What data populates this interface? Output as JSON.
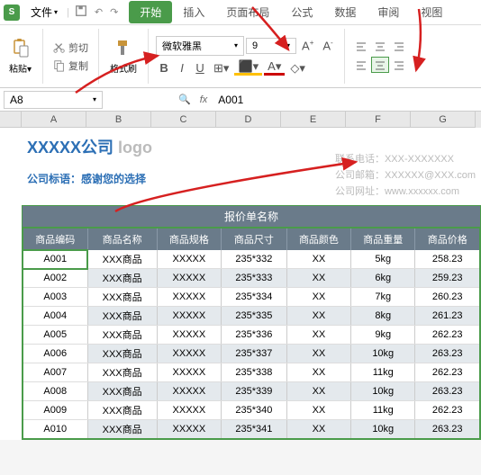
{
  "menubar": {
    "file": "文件",
    "tabs": [
      "开始",
      "插入",
      "页面布局",
      "公式",
      "数据",
      "审阅",
      "视图"
    ]
  },
  "ribbon": {
    "cut": "剪切",
    "copy": "复制",
    "format_painter": "格式刷",
    "font_name": "微软雅黑",
    "font_size": "9",
    "bold": "B",
    "italic": "I",
    "underline": "U",
    "strike_label": "A",
    "inc_font": "A",
    "dec_font": "A"
  },
  "formula_bar": {
    "name_box": "A8",
    "formula": "A001"
  },
  "columns": [
    "A",
    "B",
    "C",
    "D",
    "E",
    "F",
    "G"
  ],
  "company": {
    "name": "XXXXX公司",
    "logo": "logo",
    "slogan": "公司标语：感谢您的选择",
    "phone_label": "联系电话：",
    "phone": "XXX-XXXXXXX",
    "email_label": "公司邮箱：",
    "email": "XXXXXX@XXX.com",
    "web_label": "公司网址：",
    "web": "www.xxxxxx.com"
  },
  "table": {
    "title": "报价单名称",
    "headers": [
      "商品编码",
      "商品名称",
      "商品规格",
      "商品尺寸",
      "商品颜色",
      "商品重量",
      "商品价格"
    ],
    "rows": [
      [
        "A001",
        "XXX商品",
        "XXXXX",
        "235*332",
        "XX",
        "5kg",
        "258.23"
      ],
      [
        "A002",
        "XXX商品",
        "XXXXX",
        "235*333",
        "XX",
        "6kg",
        "259.23"
      ],
      [
        "A003",
        "XXX商品",
        "XXXXX",
        "235*334",
        "XX",
        "7kg",
        "260.23"
      ],
      [
        "A004",
        "XXX商品",
        "XXXXX",
        "235*335",
        "XX",
        "8kg",
        "261.23"
      ],
      [
        "A005",
        "XXX商品",
        "XXXXX",
        "235*336",
        "XX",
        "9kg",
        "262.23"
      ],
      [
        "A006",
        "XXX商品",
        "XXXXX",
        "235*337",
        "XX",
        "10kg",
        "263.23"
      ],
      [
        "A007",
        "XXX商品",
        "XXXXX",
        "235*338",
        "XX",
        "11kg",
        "262.23"
      ],
      [
        "A008",
        "XXX商品",
        "XXXXX",
        "235*339",
        "XX",
        "10kg",
        "263.23"
      ],
      [
        "A009",
        "XXX商品",
        "XXXXX",
        "235*340",
        "XX",
        "11kg",
        "262.23"
      ],
      [
        "A010",
        "XXX商品",
        "XXXXX",
        "235*341",
        "XX",
        "10kg",
        "263.23"
      ]
    ]
  }
}
